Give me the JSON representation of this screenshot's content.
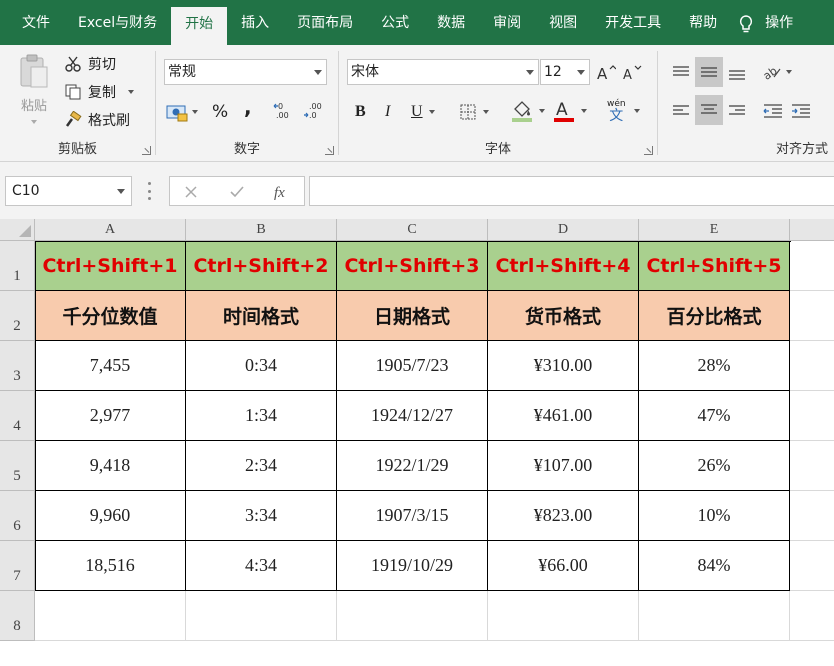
{
  "menu": {
    "tabs": [
      "文件",
      "Excel与财务",
      "开始",
      "插入",
      "页面布局",
      "公式",
      "数据",
      "审阅",
      "视图",
      "开发工具",
      "帮助"
    ],
    "active_tab": "开始",
    "tell_me": "操作"
  },
  "ribbon": {
    "clipboard": {
      "paste": "粘贴",
      "cut": "剪切",
      "copy": "复制",
      "format_painter": "格式刷",
      "label": "剪贴板"
    },
    "number": {
      "format_value": "常规",
      "percent": "%",
      "comma": ",",
      "label": "数字"
    },
    "font": {
      "font_name": "宋体",
      "font_size": "12",
      "bold": "B",
      "italic": "I",
      "underline": "U",
      "wen": "wén",
      "wen_char": "文",
      "label": "字体"
    },
    "alignment": {
      "label": "对齐方式"
    }
  },
  "formula_bar": {
    "name_box": "C10",
    "formula": ""
  },
  "sheet": {
    "columns": [
      "A",
      "B",
      "C",
      "D",
      "E"
    ],
    "rows": [
      "1",
      "2",
      "3",
      "4",
      "5",
      "6",
      "7",
      "8"
    ],
    "shortcuts": [
      "Ctrl+Shift+1",
      "Ctrl+Shift+2",
      "Ctrl+Shift+3",
      "Ctrl+Shift+4",
      "Ctrl+Shift+5"
    ],
    "headers": [
      "千分位数值",
      "时间格式",
      "日期格式",
      "货币格式",
      "百分比格式"
    ],
    "data": [
      [
        "7,455",
        "0:34",
        "1905/7/23",
        "¥310.00",
        "28%"
      ],
      [
        "2,977",
        "1:34",
        "1924/12/27",
        "¥461.00",
        "47%"
      ],
      [
        "9,418",
        "2:34",
        "1922/1/29",
        "¥107.00",
        "26%"
      ],
      [
        "9,960",
        "3:34",
        "1907/3/15",
        "¥823.00",
        "10%"
      ],
      [
        "18,516",
        "4:34",
        "1919/10/29",
        "¥66.00",
        "84%"
      ]
    ]
  },
  "colors": {
    "excel_green": "#217346",
    "header1_fill": "#a9d08e",
    "header1_text": "#e00000",
    "header2_fill": "#f8cbad"
  }
}
